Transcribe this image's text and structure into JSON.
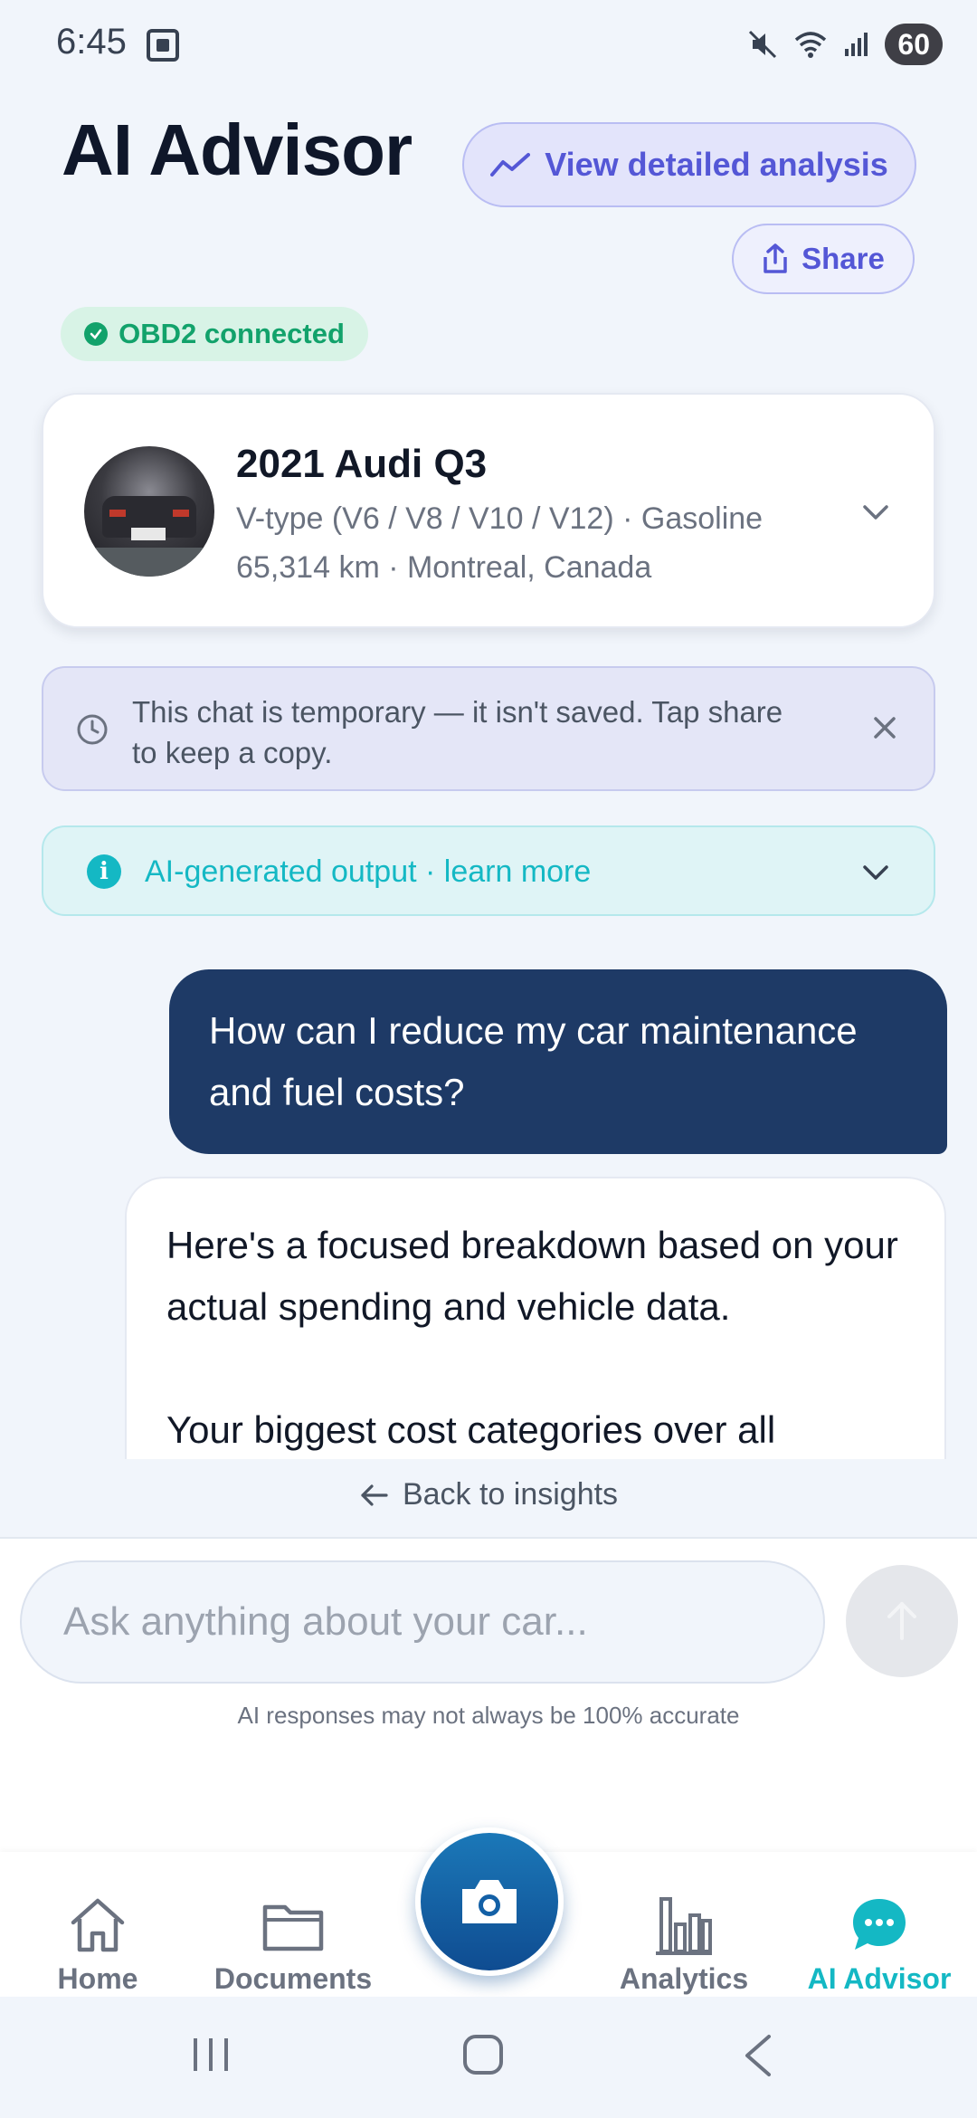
{
  "status_bar": {
    "time": "6:45",
    "battery": "60"
  },
  "header": {
    "title": "AI Advisor",
    "analysis_label": "View detailed analysis",
    "share_label": "Share"
  },
  "obd": {
    "label": "OBD2 connected"
  },
  "vehicle": {
    "name": "2021 Audi Q3",
    "engine_line": "V-type (V6 / V8 / V10 / V12) · Gasoline",
    "location_line": "65,314 km · Montreal, Canada"
  },
  "temp_banner": {
    "text": "This chat is temporary — it isn't saved. Tap share to keep a copy."
  },
  "ai_banner": {
    "text": "AI-generated output · learn more"
  },
  "chat": {
    "user_message": "How can I reduce my car maintenance and fuel costs?",
    "ai_message_p1": "Here's a focused breakdown based on your actual spending and vehicle data.",
    "ai_message_p2": "Your biggest cost categories over all"
  },
  "back_link": {
    "label": "Back to insights"
  },
  "composer": {
    "placeholder": "Ask anything about your car...",
    "disclaimer": "AI responses may not always be 100% accurate"
  },
  "bottom_nav": {
    "home": "Home",
    "documents": "Documents",
    "analytics": "Analytics",
    "ai_advisor": "AI Advisor"
  },
  "colors": {
    "accent_teal": "#14b8c4",
    "accent_indigo": "#5457d6",
    "user_bubble": "#1e3a66",
    "success": "#12a26b"
  }
}
